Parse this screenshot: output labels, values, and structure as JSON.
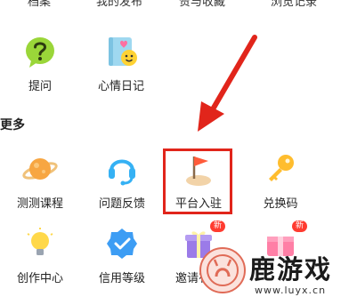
{
  "top_row": [
    "档案",
    "我的发布",
    "赞与收藏",
    "浏览记录"
  ],
  "row1": [
    {
      "label": "提问",
      "icon": "question-icon"
    },
    {
      "label": "心情日记",
      "icon": "mood-diary-icon"
    }
  ],
  "section_title": "更多",
  "more_row1": [
    {
      "label": "测测课程",
      "icon": "planet-icon"
    },
    {
      "label": "问题反馈",
      "icon": "headset-icon"
    },
    {
      "label": "平台入驻",
      "icon": "flag-icon"
    },
    {
      "label": "兑换码",
      "icon": "key-icon"
    }
  ],
  "more_row2": [
    {
      "label": "创作中心",
      "icon": "lightbulb-icon"
    },
    {
      "label": "信用等级",
      "icon": "shield-check-icon"
    },
    {
      "label": "邀请有礼",
      "icon": "gift-icon",
      "badge": "新"
    },
    {
      "label": "",
      "icon": "gift-box-icon",
      "badge": "新"
    }
  ],
  "watermark": {
    "title": "鹿游戏",
    "url": "www.luyx.cn"
  },
  "colors": {
    "highlight": "#e1251b",
    "badge": "#ff3b30"
  }
}
